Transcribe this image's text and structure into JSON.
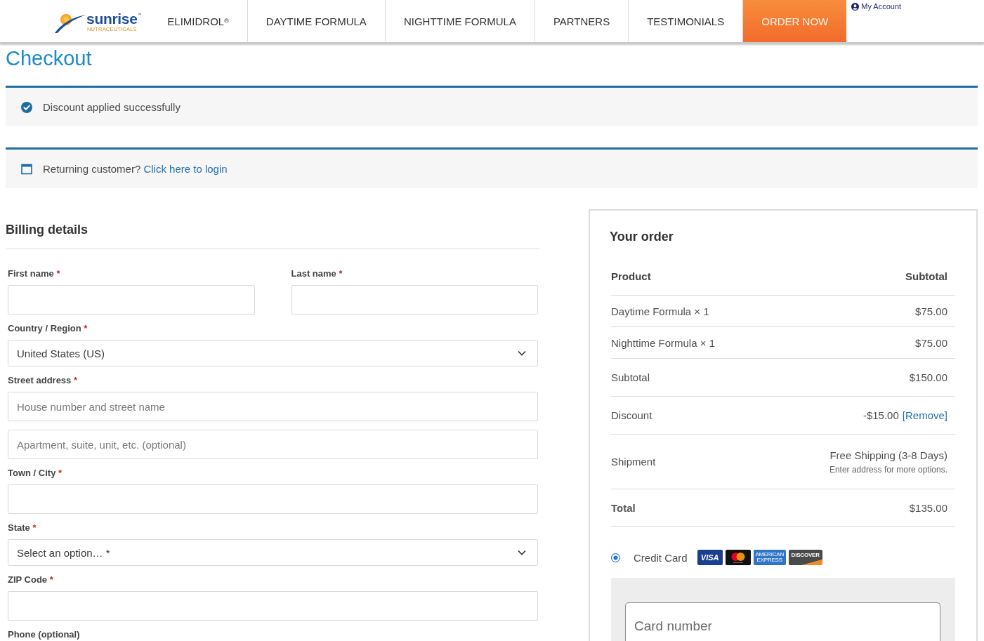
{
  "header": {
    "logo": {
      "brand": "sunrise$^{™}$",
      "tagline": "NUTRACEUTICALS"
    },
    "nav": [
      {
        "label": "ELIMIDROL$^{®}$",
        "kind": "link"
      },
      {
        "label": "DAYTIME FORMULA",
        "kind": "link"
      },
      {
        "label": "NIGHTTIME FORMULA",
        "kind": "link"
      },
      {
        "label": "PARTNERS",
        "kind": "link"
      },
      {
        "label": "TESTIMONIALS",
        "kind": "link"
      },
      {
        "label": "ORDER NOW",
        "kind": "button"
      }
    ],
    "account_link": "My Account"
  },
  "page_title": "Checkout",
  "notices": [
    {
      "kind": "success",
      "text": "Discount applied successfully"
    },
    {
      "kind": "info",
      "text": "Returning customer?",
      "link": "Click here to login"
    }
  ],
  "billing": {
    "title": "Billing details",
    "rows": [
      [
        {
          "label": "First name",
          "asterisk": "*",
          "kind": "text"
        },
        {
          "label": "Last name",
          "asterisk": "*",
          "kind": "text"
        }
      ],
      [
        {
          "label": "Country / Region",
          "asterisk": "*",
          "kind": "select",
          "value": "United States (US)"
        }
      ],
      [
        {
          "label": "Street address",
          "asterisk": "*",
          "kind": "text",
          "placeholders": [
            "House number and street name",
            "Apartment, suite, unit, etc. (optional)"
          ]
        }
      ],
      [
        {
          "label": "Town / City",
          "asterisk": "*",
          "kind": "text"
        }
      ],
      [
        {
          "label": "State",
          "asterisk": "*",
          "kind": "select",
          "value": "Select an option… *"
        }
      ],
      [
        {
          "label": "ZIP Code",
          "asterisk": "*",
          "kind": "text"
        }
      ],
      [
        {
          "label": "Phone (optional)",
          "kind": "label"
        }
      ]
    ]
  },
  "order": {
    "title": "Your order",
    "columns": [
      "Product",
      "Subtotal"
    ],
    "items": [
      {
        "name": "Daytime Formula × 1",
        "price": "$75.00"
      },
      {
        "name": "Nighttime Formula × 1",
        "price": "$75.00"
      }
    ],
    "totals": [
      {
        "kind": "subtotal",
        "label": "Subtotal",
        "value": "$150.00"
      },
      {
        "kind": "discount",
        "label": "Discount",
        "value": "-$15.00",
        "link": "[Remove]"
      },
      {
        "kind": "shipping",
        "label": "Shipment",
        "value": "Free Shipping (3-8 Days)",
        "note": "Enter address for more options."
      },
      {
        "kind": "total",
        "label": "Total",
        "value": "$135.00"
      }
    ]
  },
  "payment": {
    "methods": [
      {
        "label": "Credit Card",
        "selected": true,
        "cards": [
          {
            "kind": "visa",
            "text": "VISA"
          },
          {
            "kind": "mastercard"
          },
          {
            "kind": "amex",
            "text": "AMERICAN EXPRESS"
          },
          {
            "kind": "discover",
            "text": "DISCOVER"
          }
        ]
      }
    ],
    "card_number": {
      "placeholder": "Card number"
    }
  }
}
